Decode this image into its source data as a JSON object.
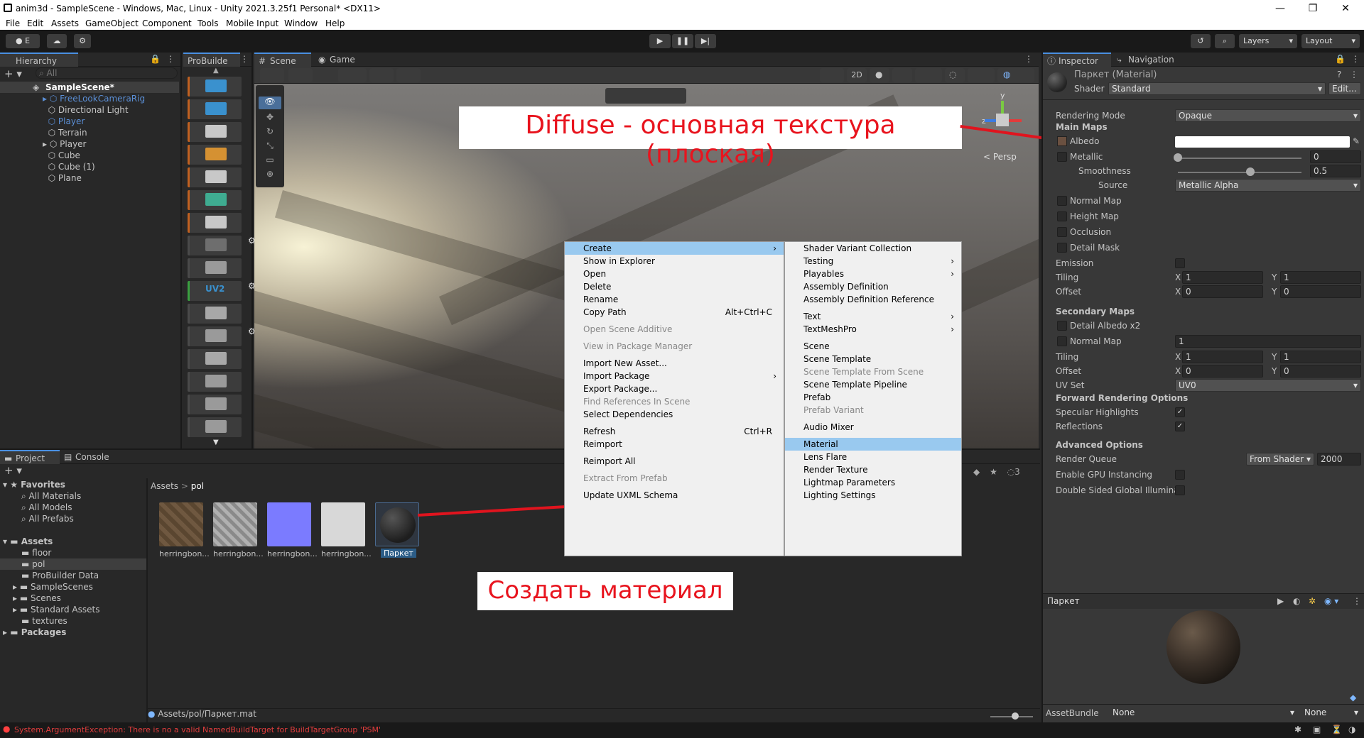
{
  "window": {
    "title": "anim3d - SampleScene - Windows, Mac, Linux - Unity 2021.3.25f1 Personal* <DX11>",
    "minimize": "—",
    "maximize": "❐",
    "close": "✕"
  },
  "menu": [
    "File",
    "Edit",
    "Assets",
    "GameObject",
    "Component",
    "Tools",
    "Mobile Input",
    "Window",
    "Help"
  ],
  "toolbar": {
    "account": "E",
    "layers": "Layers",
    "layout": "Layout"
  },
  "hierarchy": {
    "tab": "Hierarchy",
    "search": "All",
    "scene": "SampleScene*",
    "items": [
      "FreeLookCameraRig",
      "Directional Light",
      "Player",
      "Terrain",
      "Player",
      "Cube",
      "Cube (1)",
      "Plane"
    ]
  },
  "probuilder": {
    "tab": "ProBuilde",
    "uv2": "UV2"
  },
  "scene_tabs": {
    "scene": "Scene",
    "game": "Game",
    "mode2d": "2D",
    "persp": "< Persp",
    "gizmo_y": "y",
    "gizmo_z": "z"
  },
  "callouts": {
    "diffuse": "Diffuse - основная текстура (плоская)",
    "create_material": "Создать материал"
  },
  "context_menu": {
    "items": [
      "Create",
      "Show in Explorer",
      "Open",
      "Delete",
      "Rename",
      "Copy Path",
      "Open Scene Additive",
      "View in Package Manager",
      "Import New Asset...",
      "Import Package",
      "Export Package...",
      "Find References In Scene",
      "Select Dependencies",
      "Refresh",
      "Reimport",
      "Reimport All",
      "Extract From Prefab",
      "Update UXML Schema"
    ],
    "shortcuts": {
      "copy_path": "Alt+Ctrl+C",
      "refresh": "Ctrl+R"
    }
  },
  "submenu": {
    "items": [
      "Shader Variant Collection",
      "Testing",
      "Playables",
      "Assembly Definition",
      "Assembly Definition Reference",
      "Text",
      "TextMeshPro",
      "Scene",
      "Scene Template",
      "Scene Template From Scene",
      "Scene Template Pipeline",
      "Prefab",
      "Prefab Variant",
      "Audio Mixer",
      "Material",
      "Lens Flare",
      "Render Texture",
      "Lightmap Parameters",
      "Lighting Settings"
    ]
  },
  "project": {
    "tab": "Project",
    "console": "Console",
    "favorites": "Favorites",
    "fav_items": [
      "All Materials",
      "All Models",
      "All Prefabs"
    ],
    "assets": "Assets",
    "folders": [
      "floor",
      "pol",
      "ProBuilder Data",
      "SampleScenes",
      "Scenes",
      "Standard Assets",
      "textures"
    ],
    "packages": "Packages",
    "breadcrumb_root": "Assets",
    "breadcrumb_sep": ">",
    "breadcrumb_leaf": "pol",
    "thumbs": [
      "herringbon...",
      "herringbon...",
      "herringbon...",
      "herringbon...",
      "Паркет"
    ],
    "path": "Assets/pol/Паркет.mat",
    "count": "3"
  },
  "inspector": {
    "tab": "Inspector",
    "nav": "Navigation",
    "material": "Паркет (Material)",
    "shader_label": "Shader",
    "shader": "Standard",
    "edit": "Edit...",
    "rendering_mode_label": "Rendering Mode",
    "rendering_mode": "Opaque",
    "main_maps": "Main Maps",
    "albedo": "Albedo",
    "metallic": "Metallic",
    "metallic_val": "0",
    "smoothness": "Smoothness",
    "smoothness_val": "0.5",
    "source": "Source",
    "source_val": "Metallic Alpha",
    "normal_map": "Normal Map",
    "height_map": "Height Map",
    "occlusion": "Occlusion",
    "detail_mask": "Detail Mask",
    "emission": "Emission",
    "tiling": "Tiling",
    "offset": "Offset",
    "x": "X",
    "y": "Y",
    "one": "1",
    "zero": "0",
    "secondary_maps": "Secondary Maps",
    "detail_albedo": "Detail Albedo x2",
    "normal_map2": "Normal Map",
    "normal_val": "1",
    "uv_set": "UV Set",
    "uv_val": "UV0",
    "forward": "Forward Rendering Options",
    "specular": "Specular Highlights",
    "reflections": "Reflections",
    "advanced": "Advanced Options",
    "render_queue": "Render Queue",
    "from_shader": "From Shader",
    "queue_val": "2000",
    "gpu": "Enable GPU Instancing",
    "double_sided": "Double Sided Global Illuminat",
    "preview": "Паркет",
    "assetbundle": "AssetBundle",
    "none1": "None",
    "none2": "None"
  },
  "status": {
    "error": "System.ArgumentException: There is no a valid NamedBuildTarget for BuildTargetGroup 'PSM'"
  }
}
